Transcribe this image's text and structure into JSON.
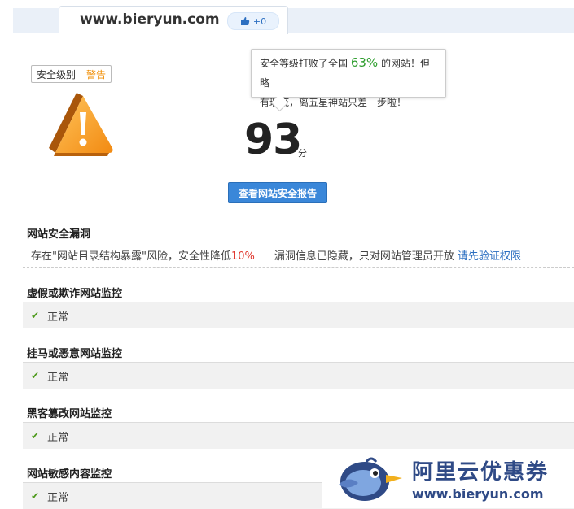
{
  "header": {
    "domain": "www.bieryun.com",
    "like_label": "+0"
  },
  "level": {
    "label": "安全级别",
    "value": "警告"
  },
  "bubble": {
    "prefix": "安全等级打败了全国",
    "percent": "63%",
    "suffix": "的网站！但略",
    "line2": "有瑕疵，离五星神站只差一步啦！"
  },
  "score": {
    "value": "93",
    "unit": "分"
  },
  "report_button": "查看网站安全报告",
  "vuln": {
    "title": "网站安全漏洞",
    "risk_prefix": "存在\"网站目录结构暴露\"风险，安全性降低",
    "risk_pct": "10%",
    "info": "漏洞信息已隐藏，只对网站管理员开放",
    "link": "请先验证权限"
  },
  "sections": [
    {
      "title": "虚假或欺诈网站监控",
      "status": "正常"
    },
    {
      "title": "挂马或恶意网站监控",
      "status": "正常"
    },
    {
      "title": "黑客篡改网站监控",
      "status": "正常"
    },
    {
      "title": "网站敏感内容监控",
      "status": "正常"
    }
  ],
  "watermark": {
    "title": "阿里云优惠券",
    "url": "www.bieryun.com"
  },
  "colors": {
    "accent_blue": "#3a87d9",
    "warning_orange": "#f08c00",
    "risk_red": "#e0352b",
    "check_green": "#4e9a1c"
  }
}
